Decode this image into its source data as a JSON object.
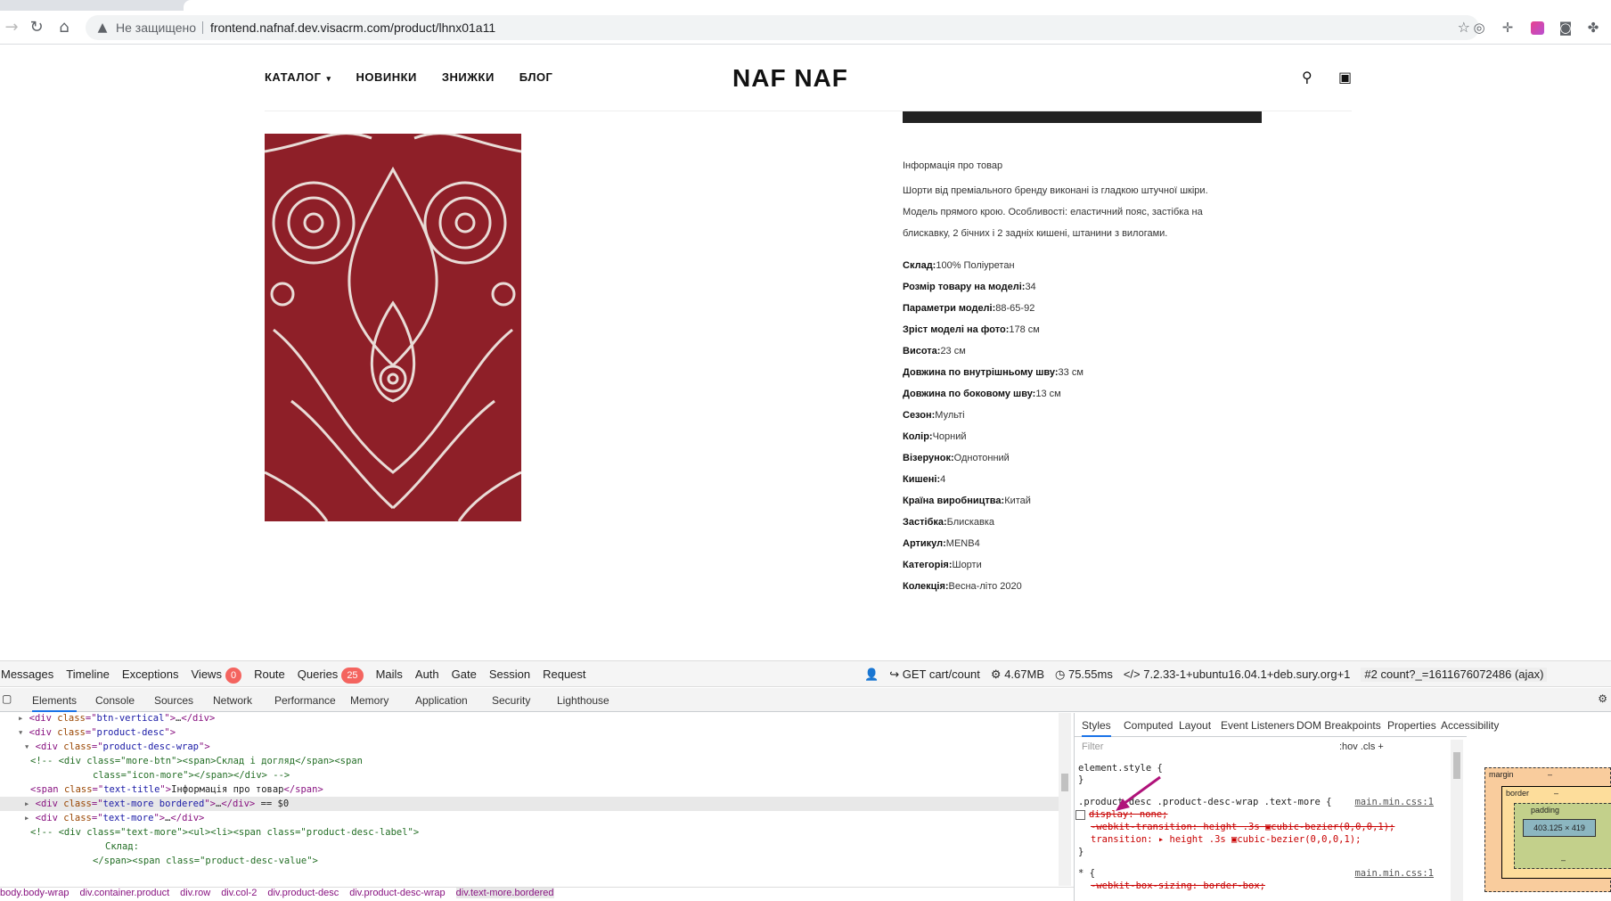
{
  "browser": {
    "security_label": "Не защищено",
    "url": "frontend.nafnaf.dev.visacrm.com/product/lhnx01a11"
  },
  "site": {
    "nav": [
      {
        "label": "КАТАЛОГ",
        "has_dropdown": true
      },
      {
        "label": "НОВИНКИ"
      },
      {
        "label": "ЗНИЖКИ"
      },
      {
        "label": "БЛОГ"
      }
    ],
    "logo": "NAF NAF"
  },
  "product": {
    "info_title": "Інформація про товар",
    "description_lines": [
      "Шорти від преміального бренду виконані із гладкою штучної шкіри.",
      "Модель прямого крою. Особливості: еластичний пояс, застібка на",
      "блискавку, 2 бічних і 2 задніх кишені, штанини з вилогами."
    ],
    "props": [
      {
        "label": "Склад:",
        "value": "100% Поліуретан"
      },
      {
        "label": "Розмір товару на моделі:",
        "value": "34"
      },
      {
        "label": "Параметри моделі:",
        "value": "88-65-92"
      },
      {
        "label": "Зріст моделі на фото:",
        "value": "178 см"
      },
      {
        "label": "Висота:",
        "value": "23 см"
      },
      {
        "label": "Довжина по внутрішньому шву:",
        "value": "33 см"
      },
      {
        "label": "Довжина по боковому шву:",
        "value": "13 см"
      },
      {
        "label": "Сезон:",
        "value": "Мульті"
      },
      {
        "label": "Колір:",
        "value": "Чорний"
      },
      {
        "label": "Візерунок:",
        "value": "Однотонний"
      },
      {
        "label": "Кишені:",
        "value": "4"
      },
      {
        "label": "Країна виробництва:",
        "value": "Китай"
      },
      {
        "label": "Застібка:",
        "value": "Блискавка"
      },
      {
        "label": "Артикул:",
        "value": "MENB4"
      },
      {
        "label": "Категорія:",
        "value": "Шорти"
      },
      {
        "label": "Колекція:",
        "value": "Весна-літо 2020"
      }
    ],
    "image_colors": {
      "base": "#8e1f28",
      "pattern": "#e9dcd7"
    }
  },
  "debugbar": {
    "tabs": [
      {
        "label": "Messages"
      },
      {
        "label": "Timeline"
      },
      {
        "label": "Exceptions"
      },
      {
        "label": "Views",
        "badge": "0"
      },
      {
        "label": "Route"
      },
      {
        "label": "Queries",
        "badge": "25"
      },
      {
        "label": "Mails"
      },
      {
        "label": "Auth"
      },
      {
        "label": "Gate"
      },
      {
        "label": "Session"
      },
      {
        "label": "Request"
      }
    ],
    "request": "GET cart/count",
    "memory": "4.67MB",
    "time": "75.55ms",
    "php": "7.2.33-1+ubuntu16.04.1+deb.sury.org+1",
    "ajax": "#2 count?_=1611676072486 (ajax)"
  },
  "devtools": {
    "tabs": [
      "Elements",
      "Console",
      "Sources",
      "Network",
      "Performance",
      "Memory",
      "Application",
      "Security",
      "Lighthouse"
    ],
    "active_tab": "Elements",
    "dom": [
      {
        "indent": 0,
        "tw": "▸",
        "parts": [
          [
            "tag",
            "<div "
          ],
          [
            "attr",
            "class"
          ],
          [
            "tag",
            "=\""
          ],
          [
            "val",
            "btn-vertical"
          ],
          [
            "tag",
            "\">"
          ],
          [
            "txt",
            "…"
          ],
          [
            "tag",
            "</div>"
          ]
        ]
      },
      {
        "indent": 0,
        "tw": "▾",
        "parts": [
          [
            "tag",
            "<div "
          ],
          [
            "attr",
            "class"
          ],
          [
            "tag",
            "=\""
          ],
          [
            "val",
            "product-desc"
          ],
          [
            "tag",
            "\">"
          ]
        ]
      },
      {
        "indent": 1,
        "tw": "▾",
        "parts": [
          [
            "tag",
            "<div "
          ],
          [
            "attr",
            "class"
          ],
          [
            "tag",
            "=\""
          ],
          [
            "val",
            "product-desc-wrap"
          ],
          [
            "tag",
            "\">"
          ]
        ]
      },
      {
        "indent": 2,
        "tw": "",
        "parts": [
          [
            "cmt",
            "<!-- <div class=\"more-btn\"><span>Склад і догляд</span><span"
          ]
        ]
      },
      {
        "indent": 12,
        "tw": "",
        "parts": [
          [
            "cmt",
            "class=\"icon-more\"></span></div> -->"
          ]
        ]
      },
      {
        "indent": 2,
        "tw": "",
        "parts": [
          [
            "tag",
            "<span "
          ],
          [
            "attr",
            "class"
          ],
          [
            "tag",
            "=\""
          ],
          [
            "val",
            "text-title"
          ],
          [
            "tag",
            "\">"
          ],
          [
            "txt",
            "Інформація про товар"
          ],
          [
            "tag",
            "</span>"
          ]
        ]
      },
      {
        "indent": 1,
        "tw": "▸",
        "sel": true,
        "parts": [
          [
            "tag",
            "<div "
          ],
          [
            "attr",
            "class"
          ],
          [
            "tag",
            "=\""
          ],
          [
            "val",
            "text-more bordered"
          ],
          [
            "tag",
            "\">"
          ],
          [
            "txt",
            "…"
          ],
          [
            "tag",
            "</div>"
          ],
          [
            "txt",
            " == $0"
          ]
        ]
      },
      {
        "indent": 1,
        "tw": "▸",
        "parts": [
          [
            "tag",
            "<div "
          ],
          [
            "attr",
            "class"
          ],
          [
            "tag",
            "=\""
          ],
          [
            "val",
            "text-more"
          ],
          [
            "tag",
            "\">"
          ],
          [
            "txt",
            "…"
          ],
          [
            "tag",
            "</div>"
          ]
        ]
      },
      {
        "indent": 2,
        "tw": "",
        "parts": [
          [
            "cmt",
            "<!-- <div class=\"text-more\"><ul><li><span class=\"product-desc-label\">"
          ]
        ]
      },
      {
        "indent": 14,
        "tw": "",
        "parts": [
          [
            "cmt",
            "Склад:"
          ]
        ]
      },
      {
        "indent": 12,
        "tw": "",
        "parts": [
          [
            "cmt",
            "</span><span class=\"product-desc-value\">"
          ]
        ]
      }
    ],
    "breadcrumbs": [
      "body.body-wrap",
      "div.container.product",
      "div.row",
      "div.col-2",
      "div.product-desc",
      "div.product-desc-wrap",
      "div.text-more.bordered"
    ],
    "styles_tabs": [
      "Styles",
      "Computed",
      "Layout",
      "Event Listeners",
      "DOM Breakpoints",
      "Properties",
      "Accessibility"
    ],
    "filter_placeholder": "Filter",
    "filter_ctrls": ":hov  .cls  +",
    "element_style": "element.style {",
    "close_brace": "}",
    "rule_selector": ".product-desc .product-desc-wrap .text-more {",
    "rule_src": "main.min.css:1",
    "rule_decls": [
      {
        "text": "display: none;",
        "struck": true,
        "checkbox": true
      },
      {
        "text": "-webkit-transition: height .3s ▣cubic-bezier(0,0,0,1);",
        "struck": true
      },
      {
        "text": "transition: ▸ height .3s ▣cubic-bezier(0,0,0,1);",
        "struck": false
      }
    ],
    "star_selector": "* {",
    "star_decl": "-webkit-box-sizing: border-box;",
    "box_model": {
      "margin": "margin",
      "border": "border",
      "padding": "padding",
      "content": "403.125 × 419",
      "dash": "–"
    }
  }
}
